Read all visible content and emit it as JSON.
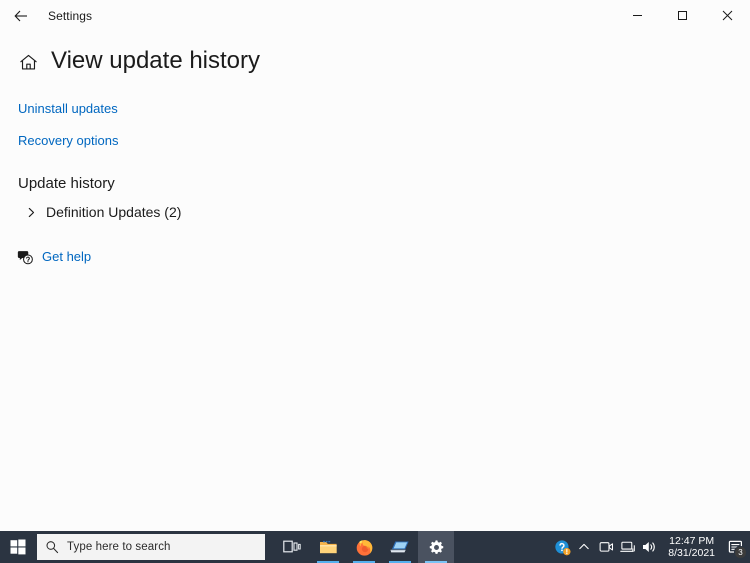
{
  "window": {
    "title": "Settings",
    "back_icon": "back-arrow-icon",
    "controls": {
      "minimize": "minimize-icon",
      "maximize": "maximize-icon",
      "close": "close-icon"
    }
  },
  "page": {
    "home_icon": "home-icon",
    "title": "View update history",
    "links": [
      {
        "label": "Uninstall updates",
        "name": "uninstall-updates-link"
      },
      {
        "label": "Recovery options",
        "name": "recovery-options-link"
      }
    ],
    "section_title": "Update history",
    "expander": {
      "label": "Definition Updates (2)",
      "icon": "chevron-right-icon",
      "expanded": false
    },
    "get_help": {
      "label": "Get help",
      "icon": "help-bubble-icon"
    }
  },
  "taskbar": {
    "start_icon": "windows-logo-icon",
    "search": {
      "icon": "search-icon",
      "placeholder": "Type here to search",
      "value": ""
    },
    "apps": [
      {
        "name": "task-view-icon",
        "label": "Task View",
        "active": false,
        "indicator": false
      },
      {
        "name": "file-explorer-icon",
        "label": "File Explorer",
        "active": false,
        "indicator": true
      },
      {
        "name": "firefox-icon",
        "label": "Firefox",
        "active": false,
        "indicator": true
      },
      {
        "name": "remote-desktop-icon",
        "label": "Remote Desktop",
        "active": false,
        "indicator": true
      },
      {
        "name": "settings-gear-icon",
        "label": "Settings",
        "active": true,
        "indicator": true
      }
    ],
    "tray": {
      "help_icon": "help-warning-icon",
      "chevron_icon": "show-hidden-icons-chevron",
      "camera_icon": "camera-icon",
      "network_icon": "network-icon",
      "volume_icon": "volume-icon",
      "time": "12:47 PM",
      "date": "8/31/2021",
      "action_center_icon": "action-center-icon",
      "notification_count": "3"
    }
  },
  "colors": {
    "accent_link": "#0067c0",
    "taskbar": "#2b3441",
    "content_bg": "#fcfcfc",
    "indicator": "#55b0ee"
  }
}
